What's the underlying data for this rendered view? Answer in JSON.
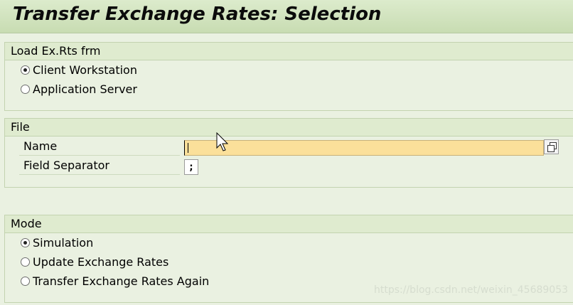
{
  "header": {
    "title": "Transfer Exchange Rates: Selection"
  },
  "load_group": {
    "title": "Load Ex.Rts frm",
    "options": [
      {
        "label": "Client Workstation",
        "selected": true
      },
      {
        "label": "Application Server",
        "selected": false
      }
    ]
  },
  "file_group": {
    "title": "File",
    "name_label": "Name",
    "name_value": "",
    "separator_label": "Field Separator",
    "separator_value": ";"
  },
  "mode_group": {
    "title": "Mode",
    "options": [
      {
        "label": "Simulation",
        "selected": true
      },
      {
        "label": "Update Exchange Rates",
        "selected": false
      },
      {
        "label": "Transfer Exchange Rates Again",
        "selected": false
      }
    ]
  },
  "watermark": "https://blog.csdn.net/weixin_45689053",
  "icons": {
    "help": "value-help-icon",
    "cursor": "mouse-cursor-icon"
  },
  "colors": {
    "background": "#eaf1e1",
    "title_bar": "#c8dcb2",
    "group_header": "#dfebcf",
    "active_input": "#fbe09a"
  }
}
